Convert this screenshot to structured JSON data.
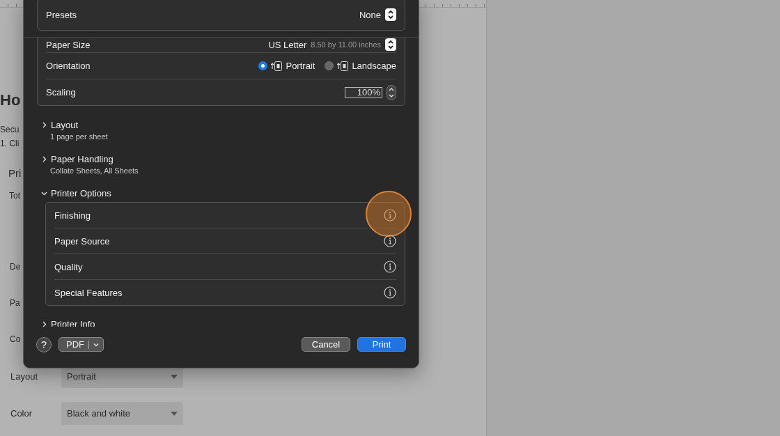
{
  "document": {
    "heading": "Ho",
    "lines": [
      "Secu",
      "1. Cli"
    ],
    "section": "Pri",
    "section_note": "Tot",
    "labels": [
      "De",
      "Pa",
      "Co"
    ],
    "fields": [
      {
        "label": "Layout",
        "value": "Portrait"
      },
      {
        "label": "Color",
        "value": "Black and white"
      }
    ]
  },
  "dialog": {
    "presets": {
      "label": "Presets",
      "value": "None"
    },
    "paper_size": {
      "label": "Paper Size",
      "value": "US Letter",
      "detail": "8.50 by 11.00 inches"
    },
    "orientation": {
      "label": "Orientation",
      "options": [
        {
          "label": "Portrait",
          "selected": true
        },
        {
          "label": "Landscape",
          "selected": false
        }
      ]
    },
    "scaling": {
      "label": "Scaling",
      "value": "100%"
    },
    "sections": [
      {
        "title": "Layout",
        "summary": "1 page per sheet",
        "expanded": false
      },
      {
        "title": "Paper Handling",
        "summary": "Collate Sheets, All Sheets",
        "expanded": false
      },
      {
        "title": "Printer Options",
        "expanded": true,
        "items": [
          {
            "label": "Finishing",
            "highlighted": true
          },
          {
            "label": "Paper Source",
            "highlighted": false
          },
          {
            "label": "Quality",
            "highlighted": false
          },
          {
            "label": "Special Features",
            "highlighted": false
          }
        ]
      },
      {
        "title": "Printer Info",
        "expanded": false
      }
    ],
    "footer": {
      "help": "?",
      "pdf": "PDF",
      "cancel": "Cancel",
      "print": "Print"
    }
  }
}
